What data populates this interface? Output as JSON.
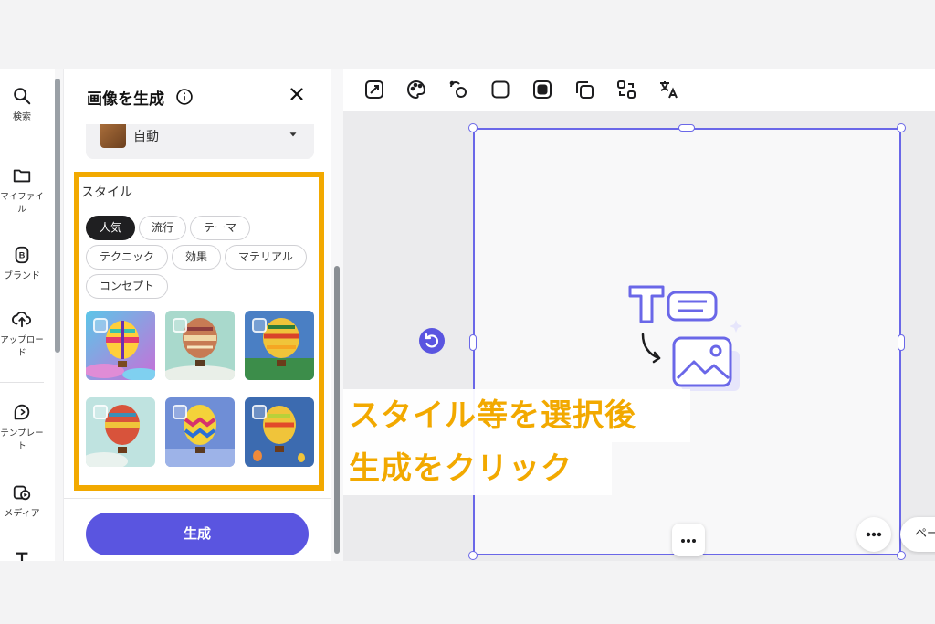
{
  "rail": {
    "items": [
      {
        "label": "検索",
        "icon": "search-icon"
      },
      {
        "label": "マイファイル",
        "icon": "folder-icon"
      },
      {
        "label": "ブランド",
        "icon": "brand-icon"
      },
      {
        "label": "アップロード",
        "icon": "upload-icon"
      },
      {
        "label": "テンプレート",
        "icon": "template-icon"
      },
      {
        "label": "メディア",
        "icon": "media-icon"
      }
    ]
  },
  "panel": {
    "title": "画像を生成",
    "dropdown_value": "自動",
    "style_heading": "スタイル",
    "chips": [
      "人気",
      "流行",
      "テーマ",
      "テクニック",
      "効果",
      "マテリアル",
      "コンセプト"
    ],
    "active_chip": "人気",
    "generate_label": "生成"
  },
  "page_pill_label": "ペー",
  "callout": {
    "line1": "スタイル等を選択後",
    "line2": "生成をクリック"
  },
  "colors": {
    "accent": "#5a55e0",
    "highlight": "#f2a900",
    "selection": "#6a67e8"
  }
}
